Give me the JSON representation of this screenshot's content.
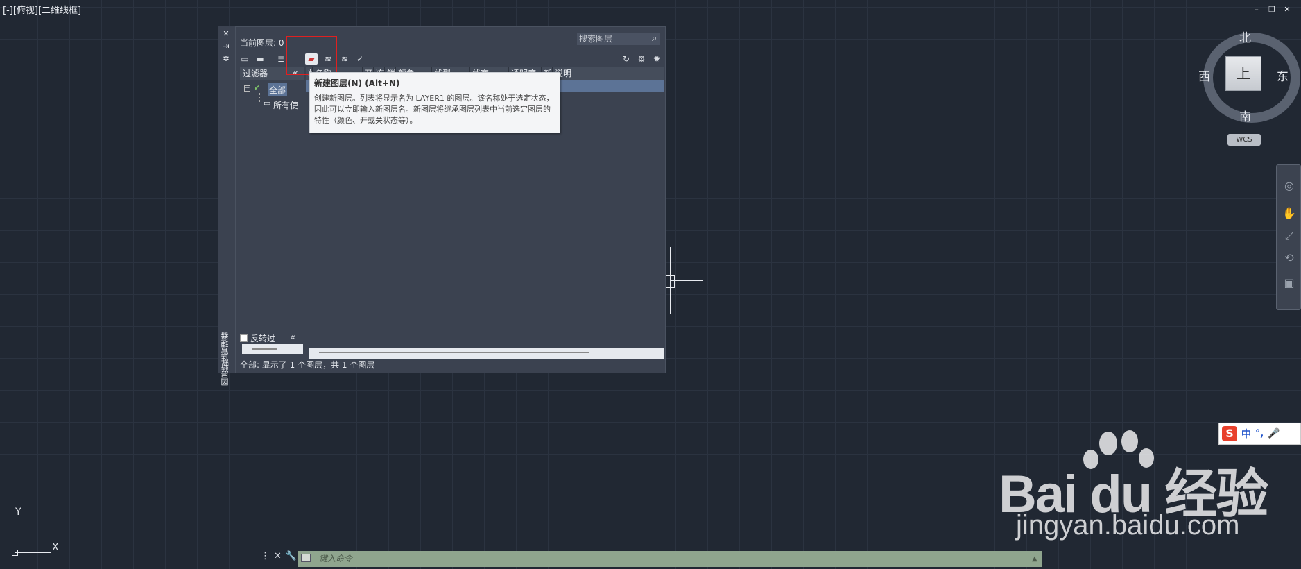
{
  "viewport": {
    "label": "[-][俯视][二维线框]"
  },
  "window_controls": [
    "–",
    "❐",
    "✕"
  ],
  "viewcube": {
    "north": "北",
    "south": "南",
    "east": "东",
    "west": "西",
    "face": "上",
    "wcs": "WCS"
  },
  "layer_dialog": {
    "side_title": "图层特性管理器",
    "current_layer": "当前图层: 0",
    "search_placeholder": "搜索图层",
    "filter_header": "过滤器",
    "tree_all": "全部",
    "tree_used": "所有使",
    "invert_label": "反转过",
    "column_headers": [
      "状",
      "名称",
      "开",
      "冻",
      "锁",
      "颜色",
      "线型",
      "线宽",
      "透明度",
      "新",
      "说明"
    ],
    "status": "全部: 显示了 1 个图层，共 1 个图层"
  },
  "tooltip": {
    "title": "新建图层(N)  (Alt+N)",
    "body": "创建新图层。列表将显示名为 LAYER1 的图层。该名称处于选定状态，因此可以立即输入新图层名。新图层将继承图层列表中当前选定图层的特性（颜色、开或关状态等）。"
  },
  "ucs": {
    "x": "X",
    "y": "Y"
  },
  "command_line": {
    "placeholder": "键入命令"
  },
  "ime": {
    "lang": "中",
    "punct": "°,"
  },
  "watermark": {
    "brand": "Bai du 经验",
    "url": "jingyan.baidu.com"
  },
  "colors": {
    "background": "#212833",
    "highlight": "#e02020",
    "selection": "#5c7396",
    "command_bar": "#8fa58e"
  }
}
